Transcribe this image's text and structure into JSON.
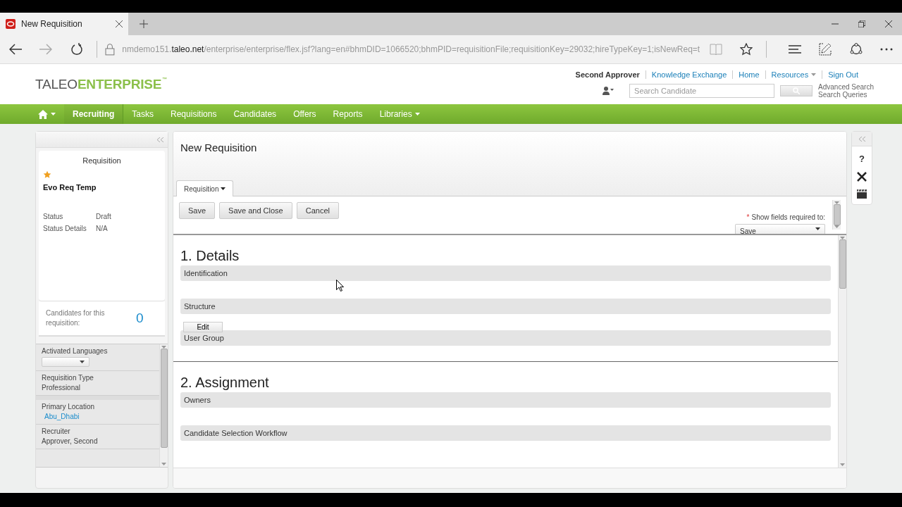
{
  "browser": {
    "tab_title": "New Requisition",
    "url_host": "nmdemo151.",
    "url_domain": "taleo.net",
    "url_path": "/enterprise/enterprise/flex.jsf?lang=en#bhmDID=1066520;bhmPID=requisitionFile;requisitionKey=29032;hireTypeKey=1;isNewReq=t"
  },
  "header": {
    "logo_left": "TALEO",
    "logo_right": "ENTERPRISE",
    "trademark": "™",
    "user": "Second Approver",
    "links": [
      {
        "label": "Knowledge Exchange",
        "dropdown": false
      },
      {
        "label": "Home",
        "dropdown": false
      },
      {
        "label": "Resources",
        "dropdown": true
      },
      {
        "label": "Sign Out",
        "dropdown": false
      }
    ],
    "search": {
      "placeholder": "Search Candidate"
    },
    "search_links": [
      "Advanced Search",
      "Search Queries"
    ]
  },
  "nav": [
    {
      "label": "Recruiting",
      "selected": true,
      "dropdown": false
    },
    {
      "label": "Tasks",
      "selected": false,
      "dropdown": false
    },
    {
      "label": "Requisitions",
      "selected": false,
      "dropdown": false
    },
    {
      "label": "Candidates",
      "selected": false,
      "dropdown": false
    },
    {
      "label": "Offers",
      "selected": false,
      "dropdown": false
    },
    {
      "label": "Reports",
      "selected": false,
      "dropdown": false
    },
    {
      "label": "Libraries",
      "selected": false,
      "dropdown": true
    }
  ],
  "summary": {
    "title": "Requisition",
    "starred": true,
    "name": "Evo Req Temp",
    "fields": [
      {
        "label": "Status",
        "value": "Draft"
      },
      {
        "label": "Status Details",
        "value": "N/A"
      }
    ],
    "candidates_label": "Candidates for this requisition:",
    "candidates_count": "0"
  },
  "side_list": [
    {
      "kind": "dropdown",
      "label": "Activated Languages"
    },
    {
      "kind": "text",
      "label": "Requisition Type",
      "value": "Professional"
    },
    {
      "kind": "link",
      "label": "Primary Location",
      "value": "Abu_Dhabi"
    },
    {
      "kind": "text",
      "label": "Recruiter",
      "value": "Approver, Second"
    }
  ],
  "main": {
    "title": "New Requisition",
    "tab": {
      "label": "Requisition",
      "selected": true
    },
    "buttons": [
      "Save",
      "Save and Close",
      "Cancel"
    ],
    "required_mark": "*",
    "required_label": "Show fields required to:",
    "required_value": "Save",
    "sections": [
      {
        "heading": "1. Details",
        "blocks": [
          {
            "label": "Identification"
          },
          {
            "label": "Structure",
            "button": "Edit"
          },
          {
            "label": "User Group"
          }
        ]
      },
      {
        "heading": "2. Assignment",
        "blocks": [
          {
            "label": "Owners"
          },
          {
            "label": "Candidate Selection Workflow"
          }
        ]
      }
    ]
  },
  "tools": {
    "help": "?"
  }
}
